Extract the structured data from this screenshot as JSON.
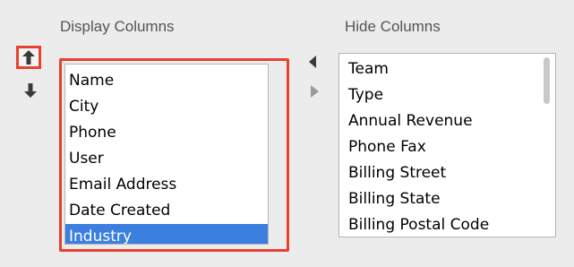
{
  "display": {
    "heading": "Display Columns",
    "items": [
      {
        "label": "Name",
        "selected": false
      },
      {
        "label": "City",
        "selected": false
      },
      {
        "label": "Phone",
        "selected": false
      },
      {
        "label": "User",
        "selected": false
      },
      {
        "label": "Email Address",
        "selected": false
      },
      {
        "label": "Date Created",
        "selected": false
      },
      {
        "label": "Industry",
        "selected": true
      }
    ]
  },
  "hide": {
    "heading": "Hide Columns",
    "items": [
      {
        "label": "Team"
      },
      {
        "label": "Type"
      },
      {
        "label": "Annual Revenue"
      },
      {
        "label": "Phone Fax"
      },
      {
        "label": "Billing Street"
      },
      {
        "label": "Billing State"
      },
      {
        "label": "Billing Postal Code"
      }
    ]
  },
  "controls": {
    "move_up_icon": "arrow-up-icon",
    "move_down_icon": "arrow-down-icon",
    "move_left_icon": "triangle-left-icon",
    "move_right_icon": "triangle-right-icon"
  },
  "colors": {
    "highlight": "#e8412f",
    "selection": "#3b7fe0",
    "background": "#ececec"
  }
}
